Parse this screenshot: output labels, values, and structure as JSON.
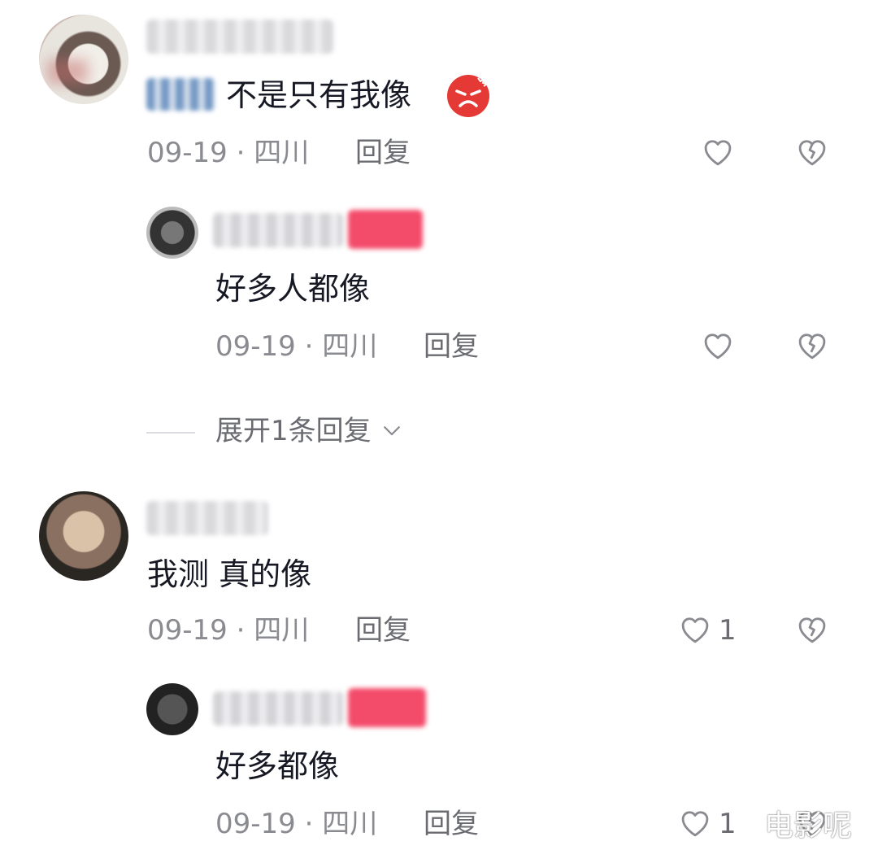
{
  "comments": [
    {
      "text": "不是只有我像",
      "emoji": "angry-face",
      "date": "09-19",
      "location": "四川",
      "reply_label": "回复",
      "likes": "",
      "replies": [
        {
          "text": "好多人都像",
          "date": "09-19",
          "location": "四川",
          "reply_label": "回复",
          "likes": ""
        }
      ],
      "expand_label": "展开1条回复"
    },
    {
      "text": "我测 真的像",
      "date": "09-19",
      "location": "四川",
      "reply_label": "回复",
      "likes": "1",
      "replies": [
        {
          "text": "好多都像",
          "date": "09-19",
          "location": "四川",
          "reply_label": "回复",
          "likes": "1"
        }
      ]
    }
  ],
  "separator": "·",
  "watermark": "电影呢",
  "colors": {
    "text": "#161823",
    "meta": "#8a8b91",
    "icon": "#8a8b91",
    "author_tag_pink": "#f2385a",
    "author_tag_blue": "#2f6fb8"
  }
}
